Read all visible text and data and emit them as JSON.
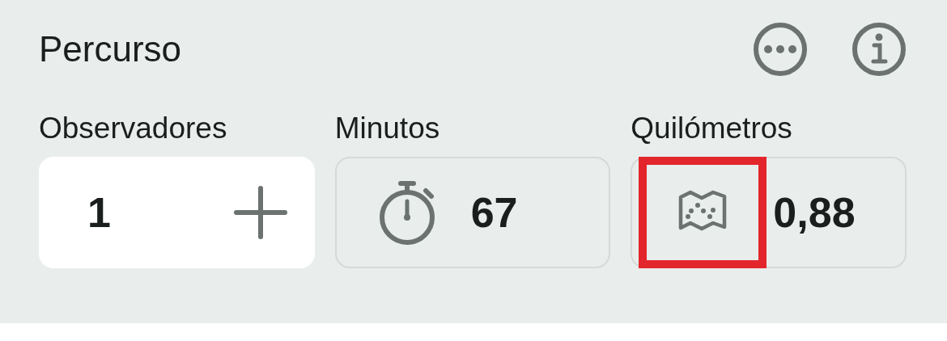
{
  "title": "Percurso",
  "fields": [
    {
      "kind": "stepper",
      "label": "Observadores",
      "value": "1"
    },
    {
      "kind": "timer",
      "label": "Minutos",
      "value": "67"
    },
    {
      "kind": "map",
      "label": "Quilómetros",
      "value": "0,88",
      "highlighted": true
    }
  ]
}
